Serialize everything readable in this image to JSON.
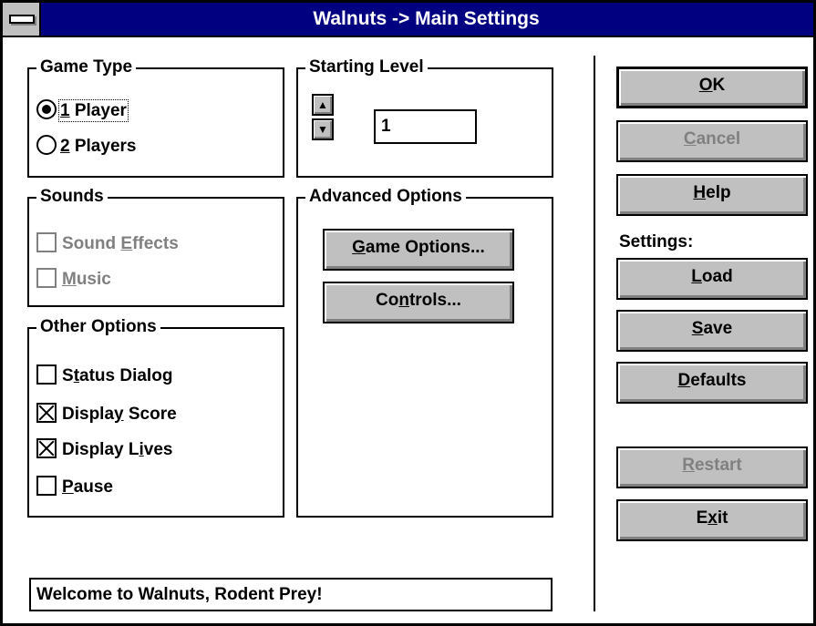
{
  "window": {
    "title": "Walnuts -> Main Settings"
  },
  "game_type": {
    "legend": "Game Type",
    "one_player": {
      "pre": "",
      "u": "1",
      "post": " Player",
      "selected": true
    },
    "two_players": {
      "pre": "",
      "u": "2",
      "post": " Players",
      "selected": false
    }
  },
  "starting_level": {
    "legend": "Starting Level",
    "value": "1",
    "up_icon": "arrow-up-icon",
    "down_icon": "arrow-down-icon"
  },
  "sounds": {
    "legend": "Sounds",
    "sound_effects": {
      "pre": "Sound ",
      "u": "E",
      "post": "ffects",
      "checked": false,
      "enabled": false
    },
    "music": {
      "pre": "",
      "u": "M",
      "post": "usic",
      "checked": false,
      "enabled": false
    }
  },
  "advanced": {
    "legend": "Advanced Options",
    "game_options": {
      "pre": "",
      "u": "G",
      "post": "ame Options..."
    },
    "controls": {
      "pre": "Co",
      "u": "n",
      "post": "trols..."
    }
  },
  "other": {
    "legend": "Other Options",
    "status_dialog": {
      "pre": "S",
      "u": "t",
      "post": "atus Dialog",
      "checked": false
    },
    "display_score": {
      "pre": "Displa",
      "u": "y",
      "post": " Score",
      "checked": true
    },
    "display_lives": {
      "pre": "Display L",
      "u": "i",
      "post": "ves",
      "checked": true
    },
    "pause": {
      "pre": "",
      "u": "P",
      "post": "ause",
      "checked": false
    }
  },
  "buttons": {
    "ok": {
      "pre": "",
      "u": "O",
      "post": "K"
    },
    "cancel": {
      "pre": "",
      "u": "C",
      "post": "ancel",
      "enabled": false
    },
    "help": {
      "pre": "",
      "u": "H",
      "post": "elp"
    },
    "settings_label": "Settings:",
    "load": {
      "pre": "",
      "u": "L",
      "post": "oad"
    },
    "save": {
      "pre": "",
      "u": "S",
      "post": "ave"
    },
    "defaults": {
      "pre": "",
      "u": "D",
      "post": "efaults"
    },
    "restart": {
      "pre": "",
      "u": "R",
      "post": "estart",
      "enabled": false
    },
    "exit": {
      "pre": "E",
      "u": "x",
      "post": "it"
    }
  },
  "status": {
    "message": "Welcome to Walnuts, Rodent Prey!"
  },
  "colors": {
    "titlebar": "#000080",
    "button_face": "#c0c0c0",
    "disabled_text": "#808080"
  }
}
